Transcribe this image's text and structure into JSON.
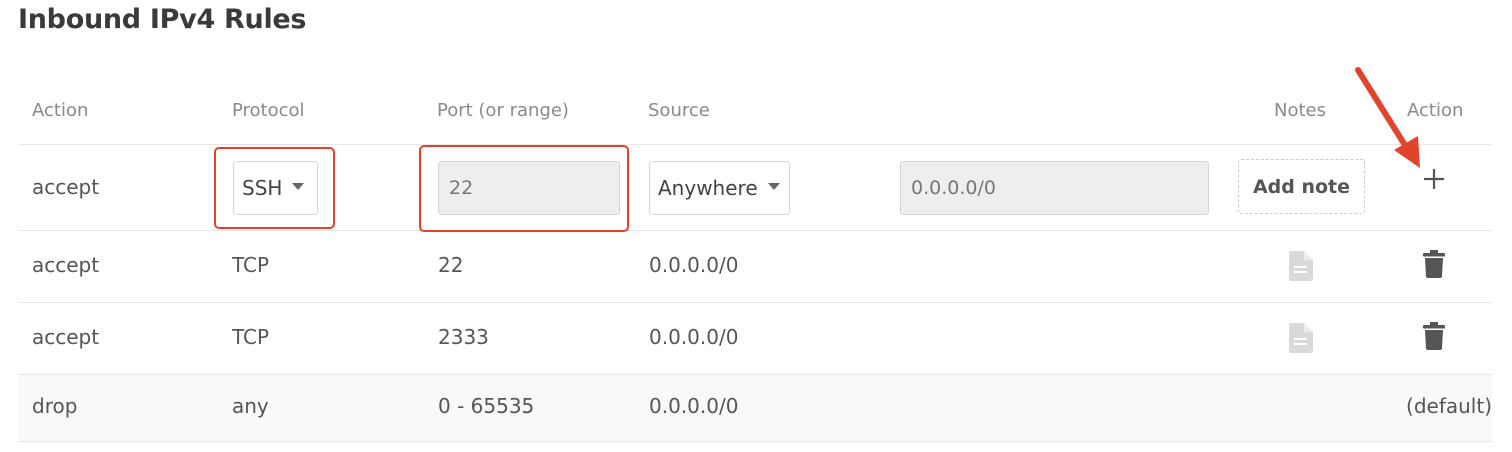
{
  "title": "Inbound IPv4 Rules",
  "columns": {
    "action": "Action",
    "protocol": "Protocol",
    "port": "Port (or range)",
    "source": "Source",
    "notes": "Notes",
    "action_end": "Action"
  },
  "new_rule": {
    "action": "accept",
    "protocol": "SSH",
    "port": "22",
    "source": "Anywhere",
    "source_ip": "0.0.0.0/0",
    "add_note": "Add note",
    "add_icon": "plus-icon"
  },
  "rules": [
    {
      "action": "accept",
      "protocol": "TCP",
      "port": "22",
      "source": "0.0.0.0/0",
      "notes_icon": "document-icon",
      "action_icon": "trash-icon"
    },
    {
      "action": "accept",
      "protocol": "TCP",
      "port": "2333",
      "source": "0.0.0.0/0",
      "notes_icon": "document-icon",
      "action_icon": "trash-icon"
    }
  ],
  "default_rule": {
    "action": "drop",
    "protocol": "any",
    "port": "0 - 65535",
    "source": "0.0.0.0/0",
    "action_label": "(default)"
  },
  "colors": {
    "highlight": "#e1442a",
    "input_bg": "#eeeeee",
    "icon_muted": "#d9d9d9",
    "icon_dark": "#555555"
  }
}
